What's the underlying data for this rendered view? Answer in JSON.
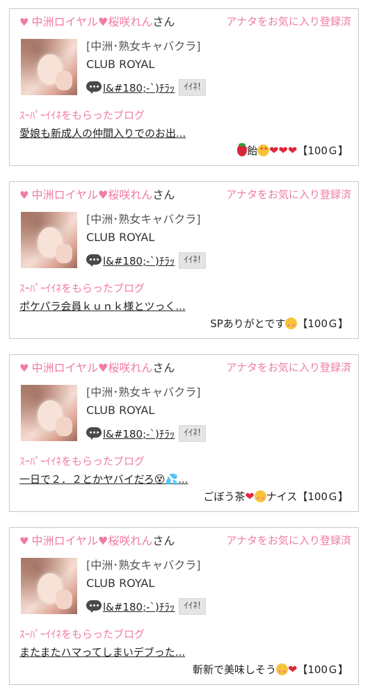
{
  "cards": [
    {
      "cast_name": "中洲ロイヤル♥桜咲れん",
      "honorific": "さん",
      "fav_label": "アナタをお気に入り登録済",
      "shop": "[中洲･熟女キャバクラ]",
      "club": "CLUB ROYAL",
      "handle": "l&#180;-`)ﾁﾗｯ",
      "iine_label": "ｲｲﾈ!",
      "super_label": "ｽｰﾊﾟｰｲｲﾈをもらったブログ",
      "blog_title": "愛娘も新成人の仲間入りでのお出...",
      "gift_text": "飴",
      "gift_price": "【100Ｇ】"
    },
    {
      "cast_name": "中洲ロイヤル♥桜咲れん",
      "honorific": "さん",
      "fav_label": "アナタをお気に入り登録済",
      "shop": "[中洲･熟女キャバクラ]",
      "club": "CLUB ROYAL",
      "handle": "l&#180;-`)ﾁﾗｯ",
      "iine_label": "ｲｲﾈ!",
      "super_label": "ｽｰﾊﾟｰｲｲﾈをもらったブログ",
      "blog_title": "ポケパラ会員ｋｕｎｋ様とツっく...",
      "gift_text": "SPありがとです",
      "gift_price": "【100Ｇ】"
    },
    {
      "cast_name": "中洲ロイヤル♥桜咲れん",
      "honorific": "さん",
      "fav_label": "アナタをお気に入り登録済",
      "shop": "[中洲･熟女キャバクラ]",
      "club": "CLUB ROYAL",
      "handle": "l&#180;-`)ﾁﾗｯ",
      "iine_label": "ｲｲﾈ!",
      "super_label": "ｽｰﾊﾟｰｲｲﾈをもらったブログ",
      "blog_title": "一日で２．２とかヤバイだろ😵💦...",
      "gift_text_a": "ごぼう茶",
      "gift_text_b": "ナイス",
      "gift_price": "【100Ｇ】"
    },
    {
      "cast_name": "中洲ロイヤル♥桜咲れん",
      "honorific": "さん",
      "fav_label": "アナタをお気に入り登録済",
      "shop": "[中洲･熟女キャバクラ]",
      "club": "CLUB ROYAL",
      "handle": "l&#180;-`)ﾁﾗｯ",
      "iine_label": "ｲｲﾈ!",
      "super_label": "ｽｰﾊﾟｰｲｲﾈをもらったブログ",
      "blog_title": "またまたハマってしまいデブった...",
      "gift_text": "斬新で美味しそう",
      "gift_price": "【100Ｇ】"
    }
  ],
  "colors": {
    "accent": "#f07ba4",
    "border": "#c9c9c9",
    "button_bg": "#e4e4e4"
  },
  "icons": [
    "heart-icon",
    "speech-bubble-icon",
    "strawberry-icon",
    "star-struck-face-icon",
    "smiling-face-with-hearts-icon",
    "red-heart-icon"
  ]
}
